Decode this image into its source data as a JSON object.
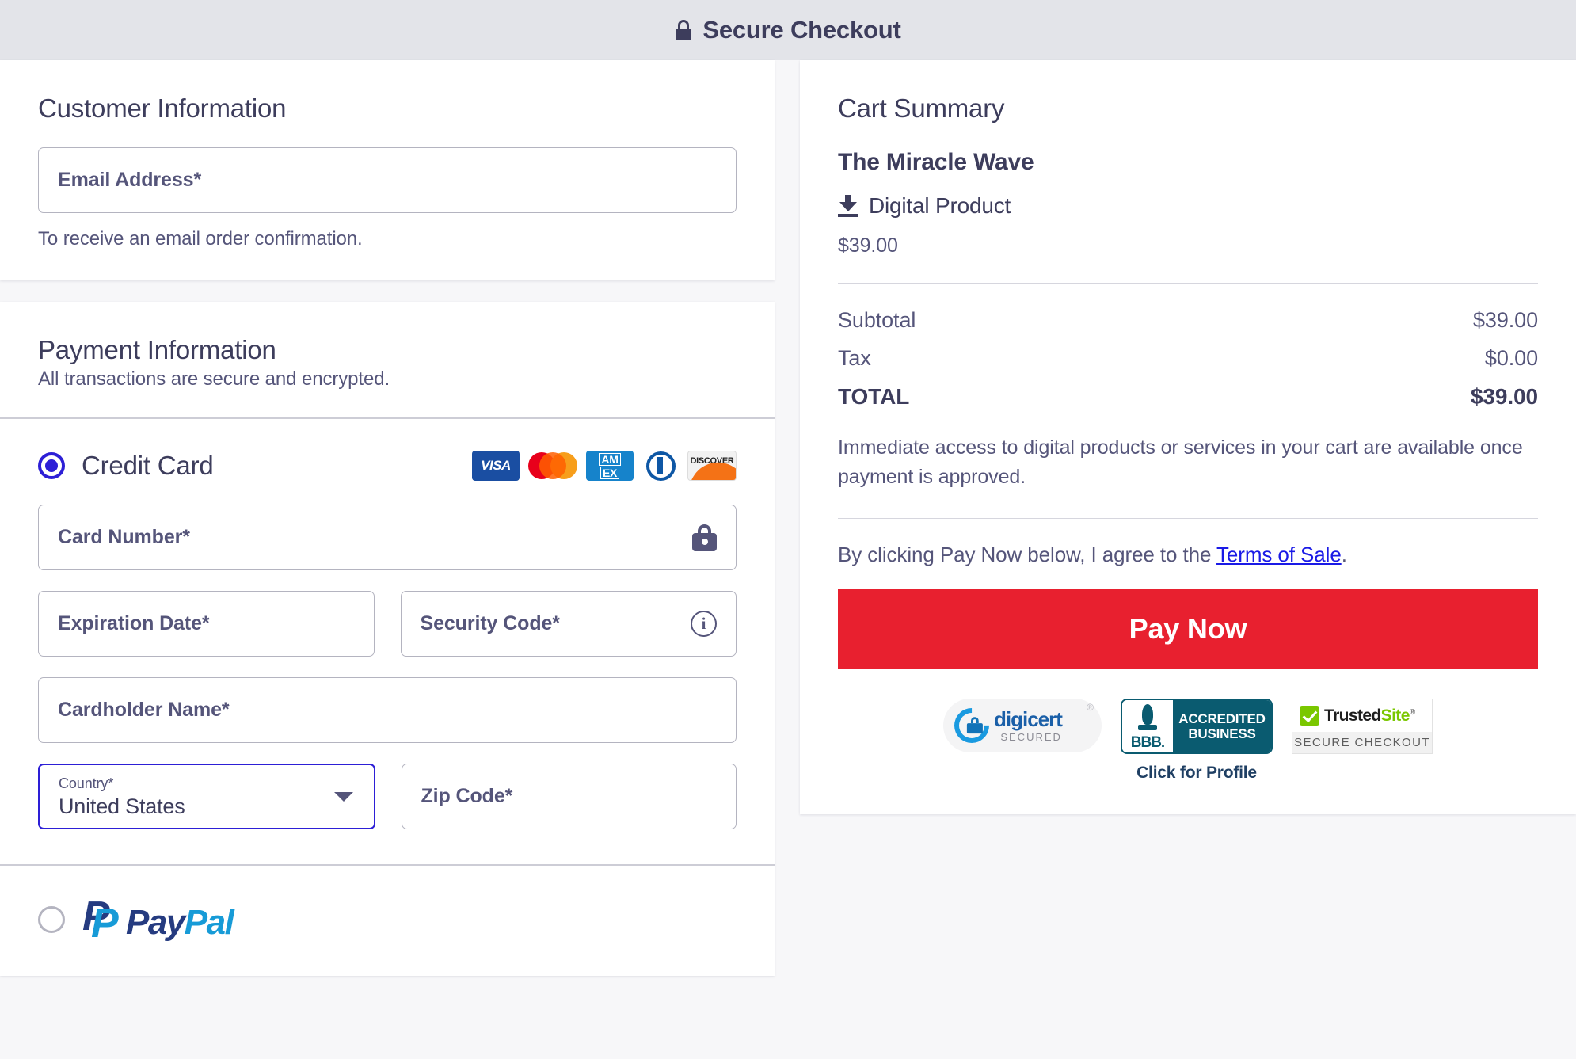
{
  "header": {
    "title": "Secure Checkout",
    "lock_icon": "lock-icon"
  },
  "customer": {
    "section_title": "Customer Information",
    "email_label": "Email Address*",
    "email_placeholder": "Email Address*",
    "email_value": "",
    "email_help": "To receive an email order confirmation."
  },
  "payment": {
    "section_title": "Payment Information",
    "subtitle": "All transactions are secure and encrypted.",
    "credit_card_label": "Credit Card",
    "credit_card_selected": true,
    "brands": [
      {
        "name": "visa",
        "text": "VISA"
      },
      {
        "name": "mastercard",
        "text": ""
      },
      {
        "name": "amex",
        "line1": "AM",
        "line2": "EX"
      },
      {
        "name": "diners-club",
        "text": ""
      },
      {
        "name": "discover",
        "text": "DISCOVER"
      }
    ],
    "card_number_label": "Card Number*",
    "card_number_value": "",
    "card_number_icon": "lock-icon",
    "expiration_label": "Expiration Date*",
    "expiration_value": "",
    "security_code_label": "Security Code*",
    "security_code_value": "",
    "security_code_icon": "info-icon",
    "cardholder_label": "Cardholder Name*",
    "cardholder_value": "",
    "country_label": "Country*",
    "country_value": "United States",
    "zip_label": "Zip Code*",
    "zip_value": "",
    "paypal_label": "PayPal",
    "paypal_selected": false
  },
  "cart": {
    "section_title": "Cart Summary",
    "product_name": "The Miracle Wave",
    "product_type": "Digital Product",
    "product_type_icon": "download-icon",
    "product_price": "$39.00",
    "rows": [
      {
        "label": "Subtotal",
        "value": "$39.00"
      },
      {
        "label": "Tax",
        "value": "$0.00"
      }
    ],
    "total_label": "TOTAL",
    "total_value": "$39.00",
    "note": "Immediate access to digital products or services in your cart are available once payment is approved.",
    "terms_prefix": "By clicking Pay Now below, I agree to the ",
    "terms_link": "Terms of Sale",
    "terms_suffix": ".",
    "pay_button": "Pay Now"
  },
  "badges": {
    "digicert": {
      "name": "digicert",
      "sub": "SECURED",
      "mark": "®"
    },
    "bbb": {
      "abbr": "BBB.",
      "line1": "ACCREDITED",
      "line2": "BUSINESS",
      "caption": "Click for Profile"
    },
    "trustedsite": {
      "part1": "Trusted",
      "part2": "Site",
      "mark": "®",
      "sub": "SECURE CHECKOUT"
    }
  },
  "colors": {
    "accent_blue": "#2d1fd6",
    "pay_button_red": "#e8202f",
    "text_dark": "#3d3d5c",
    "text_muted": "#55557a",
    "link_blue": "#1a1ae6",
    "header_bg": "#e3e4e9",
    "page_bg": "#f7f7f9"
  }
}
